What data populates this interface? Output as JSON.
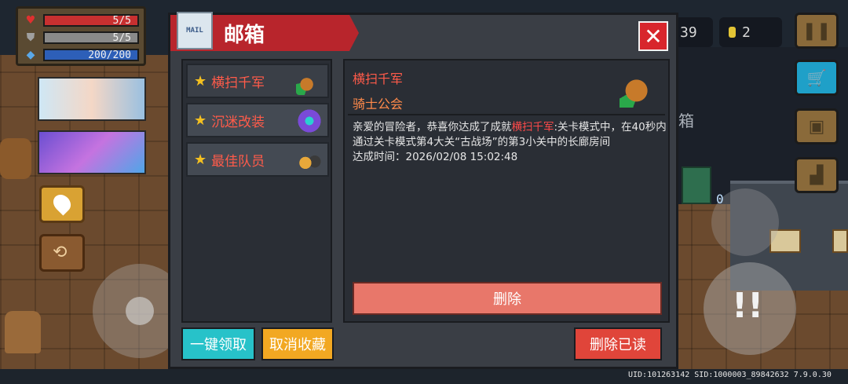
{
  "hud": {
    "hp": "5/5",
    "armor": "5/5",
    "energy": "200/200",
    "currency_partial": "39",
    "coins": "2"
  },
  "mailbox": {
    "title": "邮箱",
    "mail_icon_text": "MAIL",
    "close_icon": "close-icon",
    "items": [
      {
        "label": "横扫千军",
        "thumb_color": "#2aa84a"
      },
      {
        "label": "沉迷改装",
        "thumb_color": "#7a4ad8"
      },
      {
        "label": "最佳队员",
        "thumb_color": "#e8a83a"
      }
    ],
    "detail": {
      "title": "横扫千军",
      "sender": "骑士公会",
      "body_prefix": "亲爱的冒险者，恭喜你达成了成就",
      "body_highlight": "横扫千军",
      "body_rest": ":关卡模式中，在40秒内通过关卡模式第4大关“古战场”的第3小关中的长廊房间",
      "achieved_time": "达成时间：2026/02/08 15:02:48"
    },
    "buttons": {
      "delete": "删除",
      "claim_all": "一键领取",
      "unfavorite": "取消收藏",
      "delete_read": "删除已读"
    }
  },
  "background_sign": "箱",
  "skill_counter": "0",
  "footer": "UID:101263142 SID:1000003_89842632 7.9.0.30",
  "colors": {
    "panel_bg": "#3a3e45",
    "header_red": "#b8252c",
    "accent_red_text": "#ff5b4a",
    "claim_btn": "#27c2c9",
    "unfavorite_btn": "#f2a822",
    "delete_read_btn": "#e0453a",
    "delete_btn": "#e8776a"
  }
}
